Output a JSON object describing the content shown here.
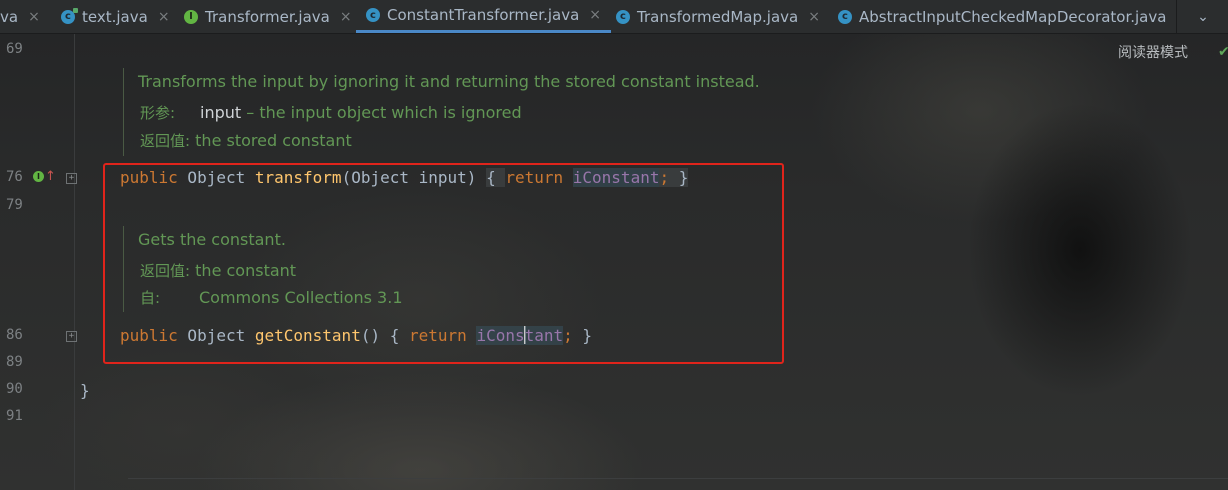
{
  "tabs": [
    {
      "label": "va",
      "icon": "none",
      "active": false
    },
    {
      "label": "text.java",
      "icon": "class-run",
      "active": false
    },
    {
      "label": "Transformer.java",
      "icon": "interface",
      "active": false
    },
    {
      "label": "ConstantTransformer.java",
      "icon": "class",
      "active": true
    },
    {
      "label": "TransformedMap.java",
      "icon": "class",
      "active": false
    },
    {
      "label": "AbstractInputCheckedMapDecorator.java",
      "icon": "class",
      "active": false
    }
  ],
  "tab_close_glyph": "×",
  "tab_more_glyph": "⌄",
  "reader_mode_label": "阅读器模式",
  "line_numbers": {
    "l69": "69",
    "l76": "76",
    "l79": "79",
    "l86": "86",
    "l89": "89",
    "l90": "90",
    "l91": "91"
  },
  "doc1": {
    "summary": "Transforms the input by ignoring it and returning the stored constant instead.",
    "param_label": "形参:",
    "param_name": "input",
    "param_desc": " – the input object which is ignored",
    "return_label": "返回值:",
    "return_desc": "the stored constant"
  },
  "code1": {
    "public": "public",
    "type": " Object ",
    "method": "transform",
    "params": "(Object input) ",
    "open": "{ ",
    "ret": "return ",
    "field": "iConstant",
    "semi": "; ",
    "close": "}"
  },
  "doc2": {
    "summary": "Gets the constant.",
    "return_label": "返回值:",
    "return_desc": "the constant",
    "since_label": "自:",
    "since_desc": "Commons Collections 3.1"
  },
  "code2": {
    "public": "public",
    "type": " Object ",
    "method": "getConstant",
    "params": "() ",
    "open": "{ ",
    "ret": "return ",
    "field_a": "iCons",
    "field_b": "tant",
    "semi": "; ",
    "close": "}"
  },
  "class_close": "}",
  "colors": {
    "keyword": "#cc7832",
    "method": "#ffc66d",
    "field": "#9876aa",
    "doc_comment": "#629755",
    "highlight_box": "#e0241b",
    "active_tab": "#4a88c7"
  }
}
